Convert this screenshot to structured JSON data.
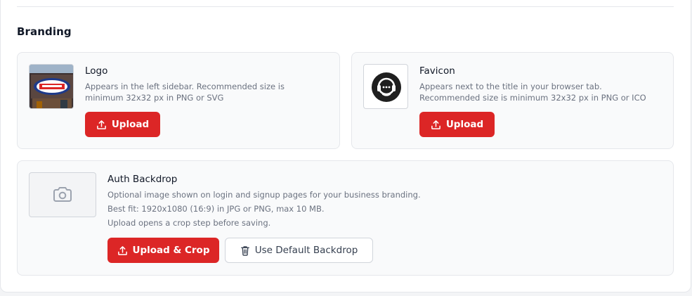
{
  "section": {
    "title": "Branding"
  },
  "logo": {
    "title": "Logo",
    "description": "Appears in the left sidebar. Recommended size is minimum 32x32 px in PNG or SVG",
    "upload_label": "Upload"
  },
  "favicon": {
    "title": "Favicon",
    "description": "Appears next to the title in your browser tab. Recommended size is minimum 32x32 px in PNG or ICO",
    "upload_label": "Upload"
  },
  "auth_backdrop": {
    "title": "Auth Backdrop",
    "description_line1": "Optional image shown on login and signup pages for your business branding.",
    "description_line2": "Best fit: 1920x1080 (16:9) in JPG or PNG, max 10 MB.",
    "description_line3": "Upload opens a crop step before saving.",
    "upload_crop_label": "Upload & Crop",
    "default_label": "Use Default Backdrop"
  },
  "colors": {
    "accent": "#dc2626",
    "panel_bg": "#f9fafb",
    "border": "#e5e7eb"
  },
  "icons": {
    "upload": "upload-icon",
    "camera": "camera-icon",
    "trash": "trash-icon",
    "headset": "headset-icon"
  }
}
